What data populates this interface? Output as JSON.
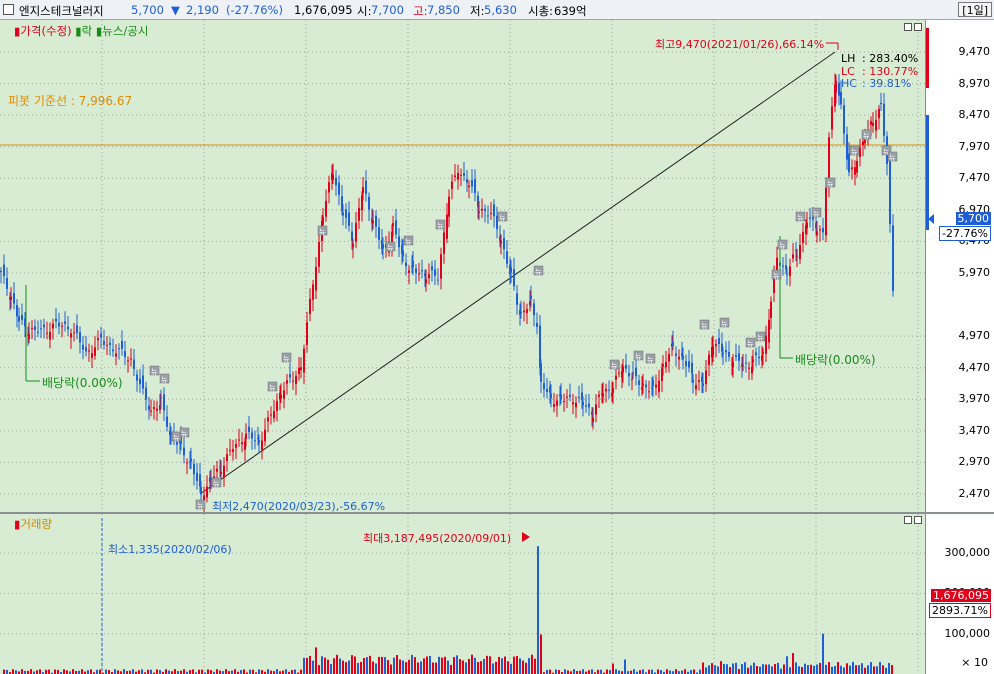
{
  "header": {
    "name": "엔지스테크널러지",
    "price": "5,700",
    "change_arrow": "▼",
    "change": "2,190",
    "change_pct": "(-27.76%)",
    "volume": "1,676,095",
    "open_label": "시:",
    "open": "7,700",
    "high_label": "고:",
    "high": "7,850",
    "low_label": "저:",
    "low": "5,630",
    "mcap_label": "시총:",
    "mcap": "639억",
    "period": "[1일]"
  },
  "price_pane": {
    "legend_price": "가격(수정)",
    "legend_ex": "락",
    "legend_news": "뉴스/공시",
    "pivot_label": "피봇 기준선 : 7,996.67",
    "pivot_value": 7996.67,
    "high_annot": "최고9,470(2021/01/26),66.14%",
    "low_annot": "최저2,470(2020/03/23),-56.67%",
    "lh_label": "LH",
    "lh_value": ": 283.40%",
    "lc_label": "LC",
    "lc_value": ": 130.77%",
    "hc_label": "HC",
    "hc_value": ": 39.81%",
    "dividend_1": "배당락(0.00%)",
    "dividend_2": "배당락(0.00%)",
    "news_glyph": "뉴",
    "current_price": "5,700",
    "current_pct": "-27.76%",
    "y_ticks": [
      "9,470",
      "8,970",
      "8,470",
      "7,970",
      "7,470",
      "6,970",
      "6,470",
      "5,970",
      "4,970",
      "4,470",
      "3,970",
      "3,470",
      "2,970",
      "2,470"
    ],
    "y_tick_values": [
      9470,
      8970,
      8470,
      7970,
      7470,
      6970,
      6470,
      5970,
      4970,
      4470,
      3970,
      3470,
      2970,
      2470
    ]
  },
  "volume_pane": {
    "legend": "거래량",
    "max_annot": "최대3,187,495(2020/09/01)",
    "min_annot": "최소1,335(2020/02/06)",
    "current_vol": "1,676,095",
    "current_pct": "2893.71%",
    "y_ticks": [
      "300,000",
      "200,000",
      "100,000"
    ],
    "y_tick_values": [
      300000,
      200000,
      100000
    ],
    "unit": "× 10"
  },
  "colors": {
    "pane_bg": "#d7ecd3",
    "up": "#e0001a",
    "down": "#1f5fd6",
    "pivot": "#e08a00",
    "dividend": "#1a8a1a"
  }
}
